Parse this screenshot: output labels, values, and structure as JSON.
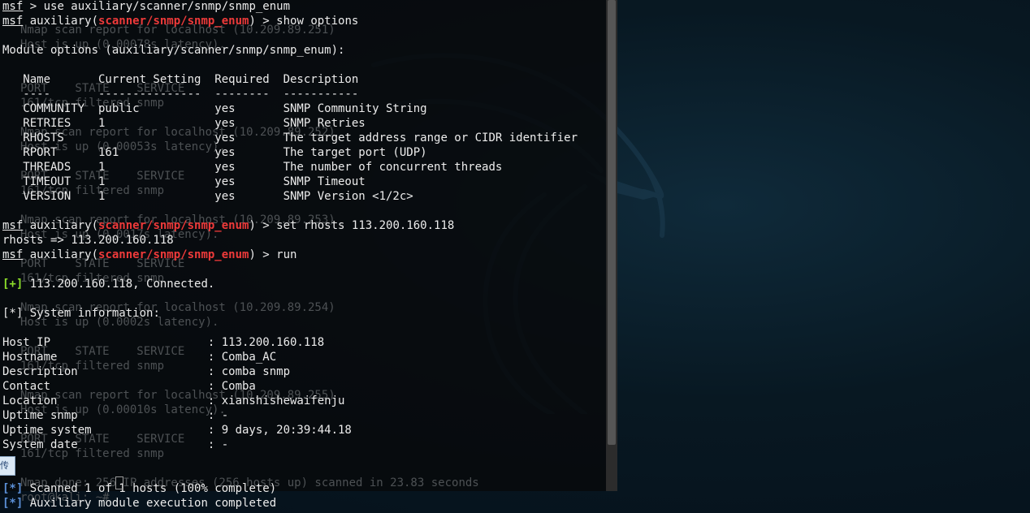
{
  "background_terminal": {
    "lines": [
      "Nmap scan report for localhost (10.209.89.251)",
      "Host is up (0.00078s latency).",
      "",
      "",
      "PORT    STATE    SERVICE",
      "161/tcp filtered snmp",
      "",
      "Nmap scan report for localhost (10.209.89.252)",
      "Host is up (0.00053s latency).",
      "",
      "PORT    STATE    SERVICE",
      "161/tcp filtered snmp",
      "",
      "Nmap scan report for localhost (10.209.89.253)",
      "Host is up (0.0017s latency).",
      "",
      "PORT    STATE    SERVICE",
      "161/tcp filtered snmp",
      "",
      "Nmap scan report for localhost (10.209.89.254)",
      "Host is up (0.0002s latency).",
      "",
      "PORT    STATE    SERVICE",
      "161/tcp filtered snmp",
      "",
      "Nmap scan report for localhost (10.209.89.255)",
      "Host is up (0.00010s latency).",
      "",
      "PORT    STATE    SERVICE",
      "161/tcp filtered snmp",
      "",
      "Nmap done: 256 IP addresses (256 hosts up) scanned in 23.83 seconds",
      "root@kali: ~#"
    ]
  },
  "terminal": {
    "prompt_word": "msf",
    "module_prefix": " auxiliary(",
    "module_name": "scanner/snmp/snmp_enum",
    "prompt_suffix": ") > ",
    "first_cmd": "msf > use auxiliary/scanner/snmp/snmp_enum",
    "cmd_show": "show options",
    "module_options_header": "Module options (auxiliary/scanner/snmp/snmp_enum):",
    "options_table": {
      "header": "   Name       Current Setting  Required  Description",
      "rule": "   ----       ---------------  --------  -----------",
      "rows": [
        "   COMMUNITY  public           yes       SNMP Community String",
        "   RETRIES    1                yes       SNMP Retries",
        "   RHOSTS                      yes       The target address range or CIDR identifier",
        "   RPORT      161              yes       The target port (UDP)",
        "   THREADS    1                yes       The number of concurrent threads",
        "   TIMEOUT    1                yes       SNMP Timeout",
        "   VERSION    1                yes       SNMP Version <1/2c>"
      ]
    },
    "cmd_set": "set rhosts 113.200.160.118",
    "set_result": "rhosts => 113.200.160.118",
    "cmd_run": "run",
    "status_plus": "[+]",
    "connected_msg": " 113.200.160.118, Connected.",
    "status_star": "[*]",
    "sysinfo_msg": " System information:",
    "sysinfo": [
      "Host IP                       : 113.200.160.118",
      "Hostname                      : Comba_AC",
      "Description                   : comba snmp",
      "Contact                       : Comba",
      "Location                      : xianshishewaifenju",
      "Uptime snmp                   : -",
      "Uptime system                 : 9 days, 20:39:44.18",
      "System date                   : -"
    ],
    "scanned_msg": " Scanned 1 of 1 hosts (100% complete)",
    "completed_msg": " Auxiliary module execution completed"
  },
  "panel_tab_label": "传"
}
